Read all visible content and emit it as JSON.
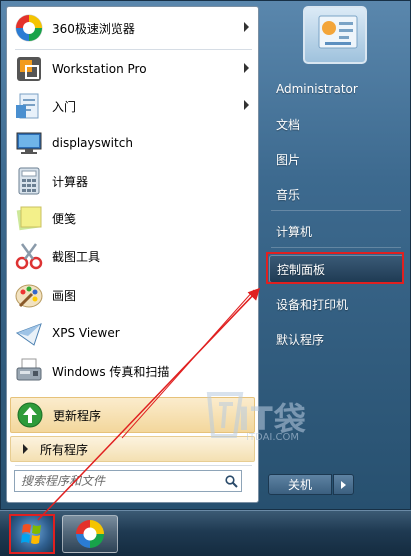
{
  "programs": [
    {
      "label": "360极速浏览器",
      "icon": "360-browser-icon",
      "has_submenu": true
    },
    {
      "label": "Workstation Pro",
      "icon": "vmware-icon",
      "has_submenu": true
    },
    {
      "label": "入门",
      "icon": "getting-started-icon",
      "has_submenu": true
    },
    {
      "label": "displayswitch",
      "icon": "monitor-icon",
      "has_submenu": false
    },
    {
      "label": "计算器",
      "icon": "calculator-icon",
      "has_submenu": false
    },
    {
      "label": "便笺",
      "icon": "sticky-note-icon",
      "has_submenu": false
    },
    {
      "label": "截图工具",
      "icon": "scissors-icon",
      "has_submenu": false
    },
    {
      "label": "画图",
      "icon": "paint-palette-icon",
      "has_submenu": false
    },
    {
      "label": "XPS Viewer",
      "icon": "xps-viewer-icon",
      "has_submenu": false
    },
    {
      "label": "Windows 传真和扫描",
      "icon": "fax-scanner-icon",
      "has_submenu": false
    }
  ],
  "update": {
    "label": "更新程序",
    "icon": "green-up-arrow-icon"
  },
  "all_programs": {
    "label": "所有程序"
  },
  "search": {
    "placeholder": "搜索程序和文件"
  },
  "right_pane": {
    "user": "Administrator",
    "items": [
      "文档",
      "图片",
      "音乐",
      "计算机",
      "控制面板",
      "设备和打印机",
      "默认程序"
    ],
    "highlighted": "控制面板"
  },
  "shutdown": {
    "label": "关机"
  },
  "watermark": {
    "text": "IT袋",
    "sub": "ITDAI.COM"
  },
  "colors": {
    "highlight_box": "#e02020",
    "accent": "#2f5f8f"
  }
}
